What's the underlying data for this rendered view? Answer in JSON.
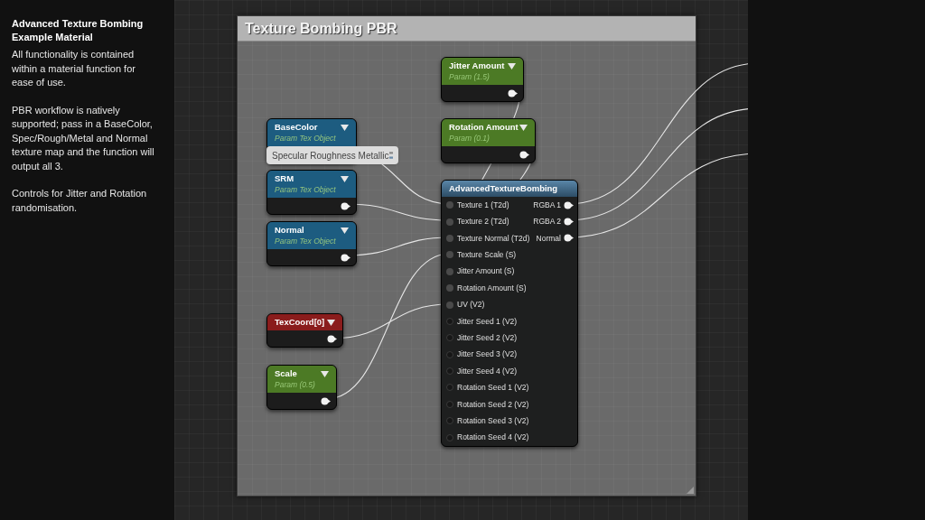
{
  "sidebar": {
    "title": "Advanced Texture Bombing Example Material",
    "paragraphs": [
      "All functionality is contained within a material function for ease of use.",
      "PBR workflow is natively supported; pass in a BaseColor, Spec/Rough/Metal and Normal texture map and the function will output all 3.",
      "Controls for Jitter and Rotation randomisation."
    ]
  },
  "comment": {
    "title": "Texture Bombing PBR"
  },
  "nodes": [
    {
      "title": "Jitter Amount",
      "subtitle": "Param (1.5)",
      "color": "#4c7a25"
    },
    {
      "title": "BaseColor",
      "subtitle": "Param Tex Object",
      "color": "#1d5c80",
      "tooltip": "Specular Roughness Metallic"
    },
    {
      "title": "Rotation Amount",
      "subtitle": "Param (0.1)",
      "color": "#4c7a25"
    },
    {
      "title": "SRM",
      "subtitle": "Param Tex Object",
      "color": "#1d5c80"
    },
    {
      "title": "Normal",
      "subtitle": "Param Tex Object",
      "color": "#1d5c80"
    },
    {
      "title": "TexCoord[0]",
      "color": "#8a1c1c"
    },
    {
      "title": "Scale",
      "subtitle": "Param (0.5)",
      "color": "#4c7a25"
    }
  ],
  "function_node": {
    "title": "AdvancedTextureBombing",
    "inputs": [
      {
        "label": "Texture 1 (T2d)",
        "connected": true
      },
      {
        "label": "Texture 2 (T2d)",
        "connected": true
      },
      {
        "label": "Texture Normal (T2d)",
        "connected": true
      },
      {
        "label": "Texture Scale (S)",
        "connected": true
      },
      {
        "label": "Jitter Amount (S)",
        "connected": true
      },
      {
        "label": "Rotation Amount (S)",
        "connected": true
      },
      {
        "label": "UV (V2)",
        "connected": true
      },
      {
        "label": "Jitter Seed 1 (V2)",
        "connected": false
      },
      {
        "label": "Jitter Seed 2 (V2)",
        "connected": false
      },
      {
        "label": "Jitter Seed 3 (V2)",
        "connected": false
      },
      {
        "label": "Jitter Seed 4 (V2)",
        "connected": false
      },
      {
        "label": "Rotation Seed 1 (V2)",
        "connected": false
      },
      {
        "label": "Rotation Seed 2 (V2)",
        "connected": false
      },
      {
        "label": "Rotation Seed 3 (V2)",
        "connected": false
      },
      {
        "label": "Rotation Seed 4 (V2)",
        "connected": false
      }
    ],
    "outputs": [
      "RGBA 1",
      "RGBA 2",
      "Normal"
    ]
  }
}
